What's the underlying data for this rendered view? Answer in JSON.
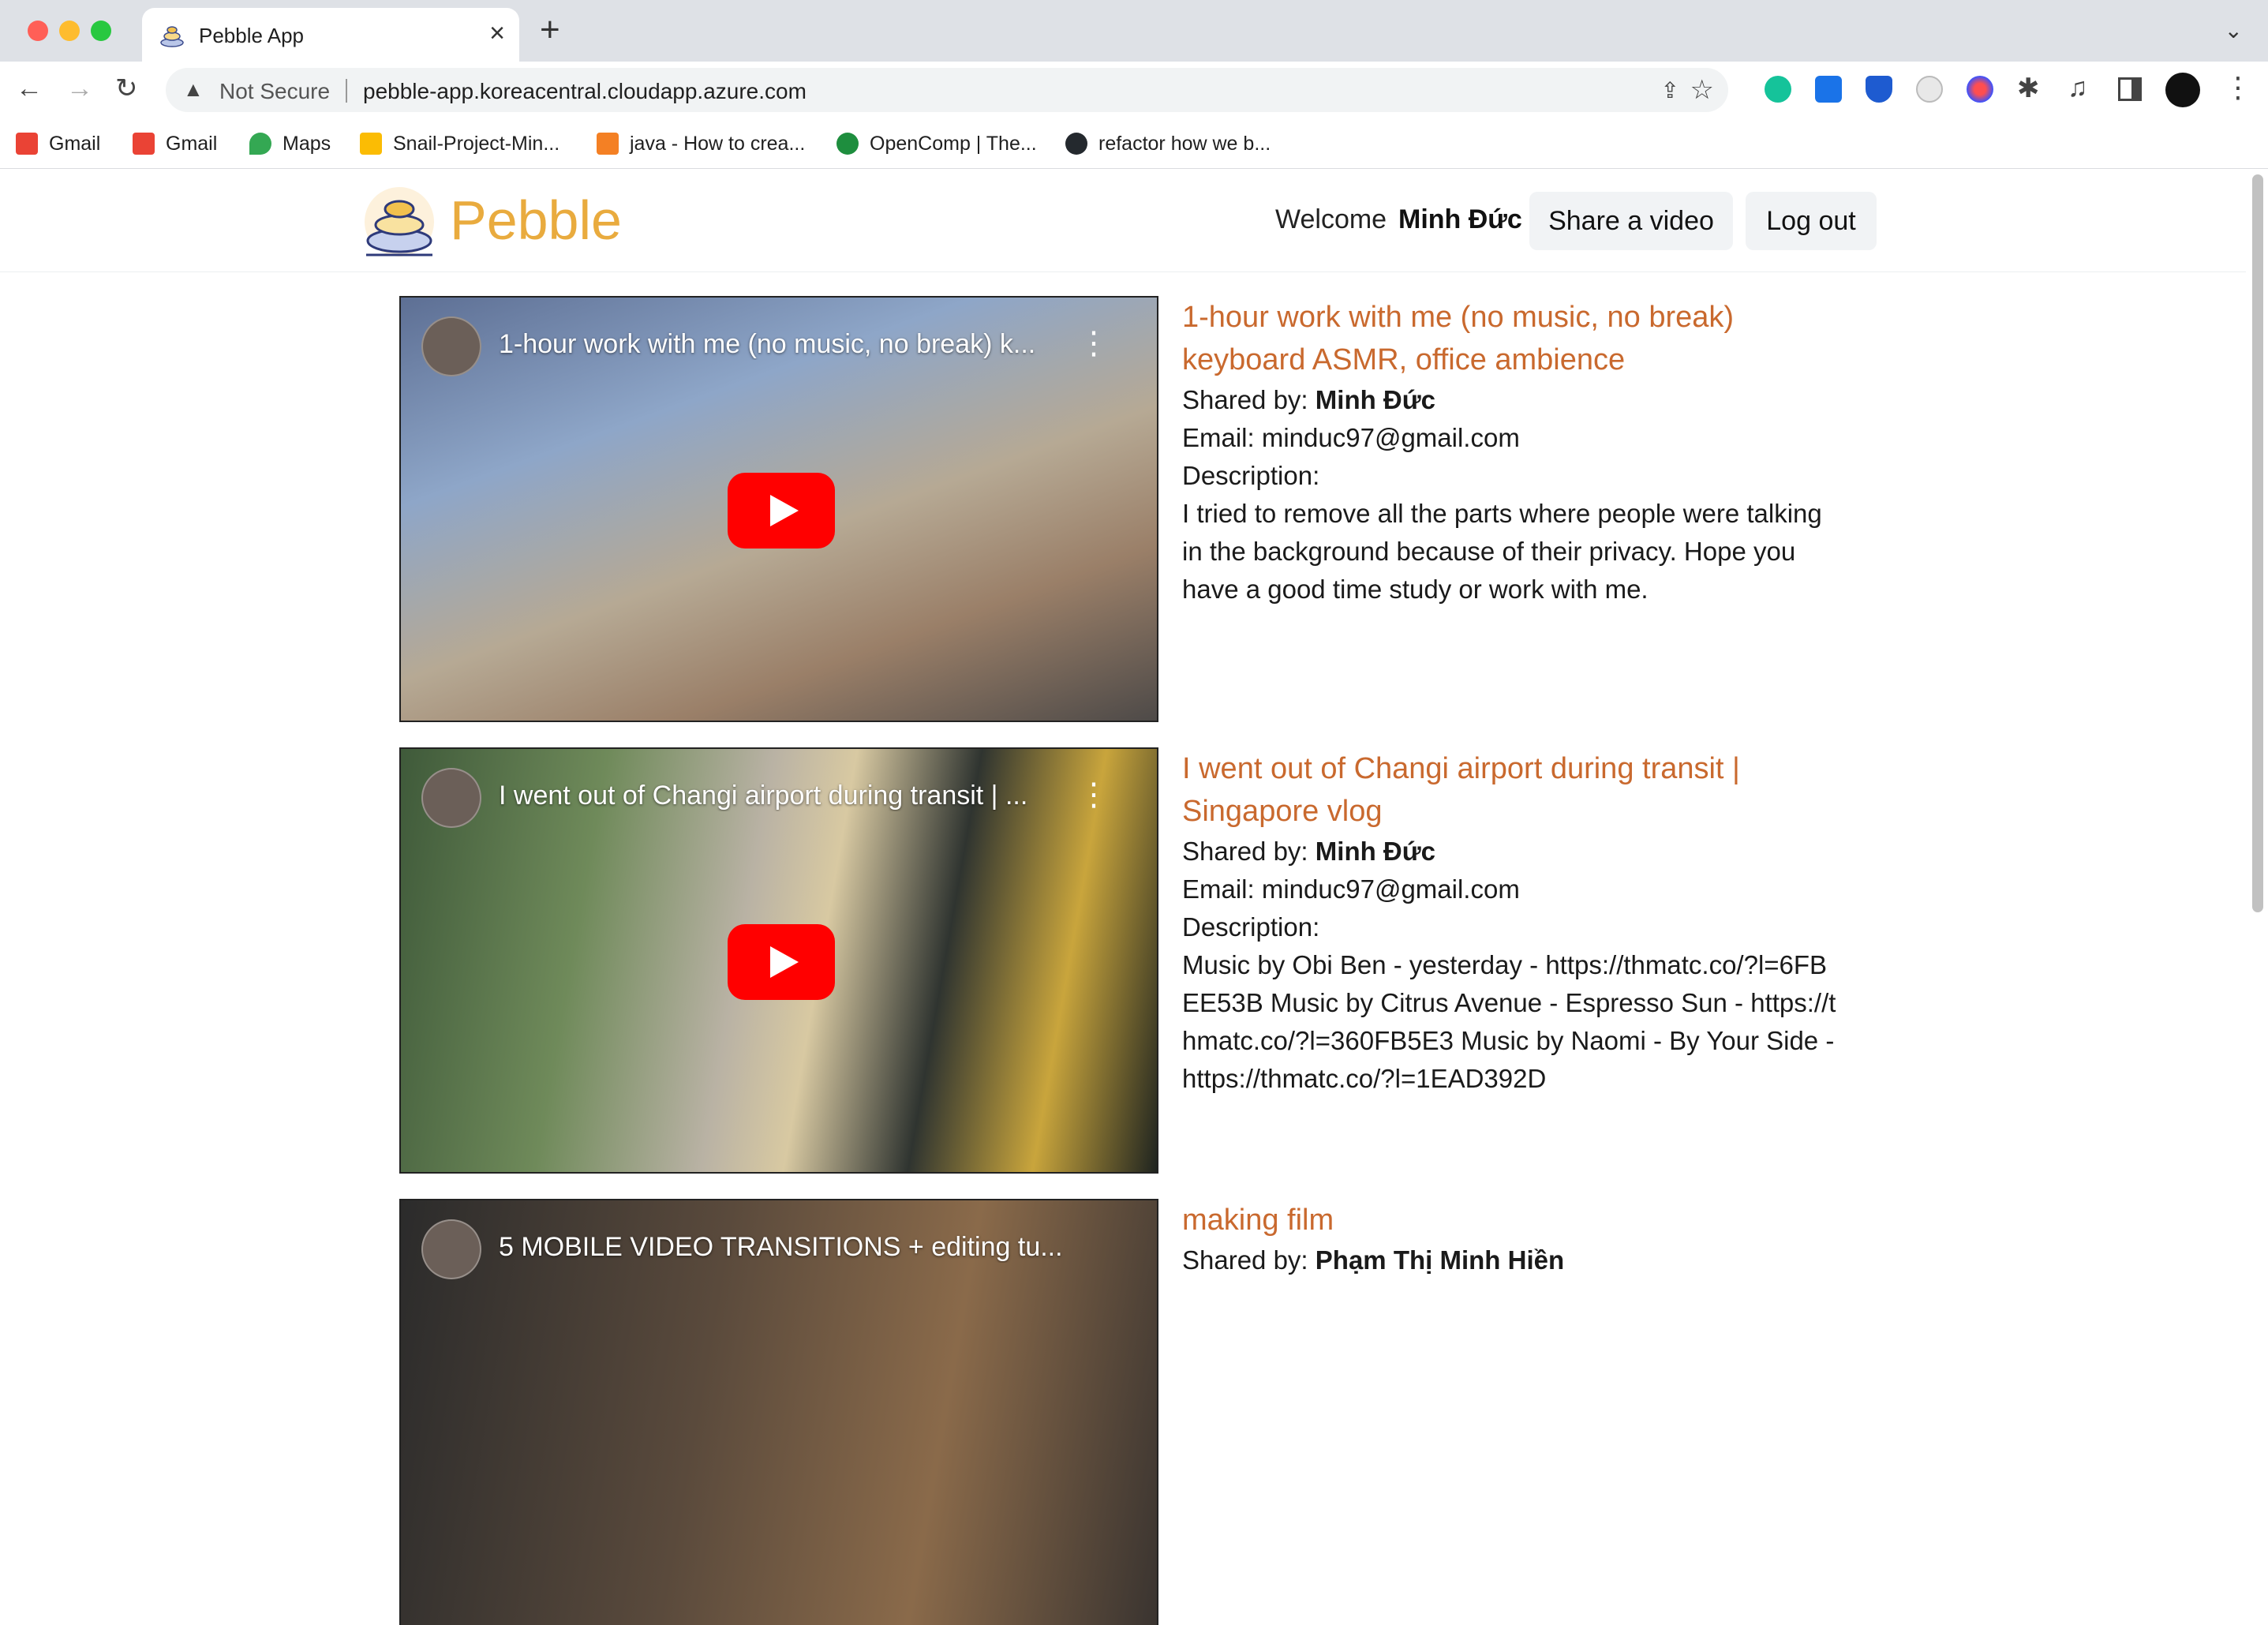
{
  "browser": {
    "tab_title": "Pebble App",
    "security_label": "Not Secure",
    "url": "pebble-app.koreacentral.cloudapp.azure.com",
    "bookmarks": [
      {
        "label": "Gmail",
        "icon": "gmail-icon",
        "color": "#ea4335"
      },
      {
        "label": "Gmail",
        "icon": "gmail-icon",
        "color": "#ea4335"
      },
      {
        "label": "Maps",
        "icon": "maps-icon",
        "color": "#34a853"
      },
      {
        "label": "Snail-Project-Min...",
        "icon": "drive-icon",
        "color": "#fbbc04"
      },
      {
        "label": "java - How to crea...",
        "icon": "stackoverflow-icon",
        "color": "#f48024"
      },
      {
        "label": "OpenComp | The...",
        "icon": "opencomp-icon",
        "color": "#1e8e3e"
      },
      {
        "label": "refactor how we b...",
        "icon": "github-icon",
        "color": "#24292e"
      }
    ]
  },
  "app": {
    "brand": "Pebble",
    "welcome_label": "Welcome",
    "user_name": "Minh Đức",
    "share_button": "Share a video",
    "logout_button": "Log out",
    "brand_color": "#e9ab3e",
    "title_color": "#c9692e"
  },
  "labels": {
    "shared_by": "Shared by:",
    "email": "Email:",
    "description": "Description:"
  },
  "videos": [
    {
      "thumb_title": "1-hour work with me (no music, no break) k...",
      "title": "1-hour work with me (no music, no break) keyboard ASMR, office ambience",
      "shared_by": "Minh Đức",
      "email": "minduc97@gmail.com",
      "description": "I tried to remove all the parts where people were talking in the background because of their privacy. Hope you have a good time study or work with me."
    },
    {
      "thumb_title": "I went out of Changi airport during transit | ...",
      "title": "I went out of Changi airport during transit | Singapore vlog",
      "shared_by": "Minh Đức",
      "email": "minduc97@gmail.com",
      "description": "Music by Obi Ben - yesterday - https://thmatc.co/?l=6FBEE53B Music by Citrus Avenue - Espresso Sun - https://thmatc.co/?l=360FB5E3 Music by Naomi - By Your Side - https://thmatc.co/?l=1EAD392D"
    },
    {
      "thumb_title": "5 MOBILE VIDEO TRANSITIONS + editing tu...",
      "title": "making film",
      "shared_by": "Phạm Thị Minh Hiền",
      "email": "",
      "description": ""
    }
  ]
}
